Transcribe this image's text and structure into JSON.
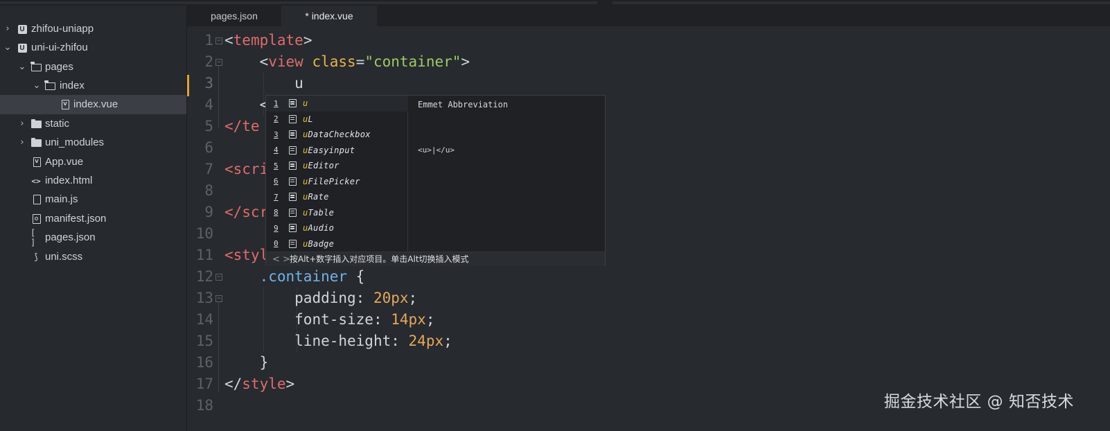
{
  "sidebar": {
    "items": [
      {
        "label": "zhifou-uniapp",
        "icon": "uniapp-project-icon"
      },
      {
        "label": "uni-ui-zhifou",
        "icon": "uniapp-project-icon"
      },
      {
        "label": "pages",
        "icon": "folder-open-icon"
      },
      {
        "label": "index",
        "icon": "folder-open-icon"
      },
      {
        "label": "index.vue",
        "icon": "vue-file-icon"
      },
      {
        "label": "static",
        "icon": "folder-icon"
      },
      {
        "label": "uni_modules",
        "icon": "folder-icon"
      },
      {
        "label": "App.vue",
        "icon": "vue-file-icon"
      },
      {
        "label": "index.html",
        "icon": "html-file-icon"
      },
      {
        "label": "main.js",
        "icon": "js-file-icon"
      },
      {
        "label": "manifest.json",
        "icon": "manifest-file-icon"
      },
      {
        "label": "pages.json",
        "icon": "json-file-icon"
      },
      {
        "label": "uni.scss",
        "icon": "scss-file-icon"
      }
    ],
    "selected": "index.vue"
  },
  "tabs": [
    {
      "label": "pages.json",
      "active": false
    },
    {
      "label": "* index.vue",
      "active": true
    }
  ],
  "editor": {
    "line_numbers": [
      "1",
      "2",
      "3",
      "4",
      "5",
      "6",
      "7",
      "8",
      "9",
      "10",
      "11",
      "12",
      "13",
      "14",
      "15",
      "16",
      "17",
      "18"
    ],
    "current_line": 3,
    "code": {
      "l1": {
        "open": "<",
        "tag": "template",
        "close": ">"
      },
      "l2": {
        "indent": "    ",
        "open": "<",
        "tag": "view",
        "attr": " class",
        "eq": "=",
        "str": "\"container\"",
        "close": ">"
      },
      "l3": {
        "indent": "        ",
        "text": "u"
      },
      "l4": {
        "indent": "    ",
        "text": "<"
      },
      "l5": {
        "text": "</te"
      },
      "l7": {
        "text": "<scri"
      },
      "l9": {
        "text": "</scr"
      },
      "l11": {
        "text": "<styl"
      },
      "l12": {
        "indent": "    ",
        "selector": ".container",
        "brace": " {"
      },
      "l13": {
        "indent": "        ",
        "prop": "padding",
        "colon": ": ",
        "value": "20px",
        "semi": ";"
      },
      "l14": {
        "indent": "        ",
        "prop": "font-size",
        "colon": ": ",
        "value": "14px",
        "semi": ";"
      },
      "l15": {
        "indent": "        ",
        "prop": "line-height",
        "colon": ": ",
        "value": "24px",
        "semi": ";"
      },
      "l16": {
        "indent": "    ",
        "text": "}"
      },
      "l17": {
        "open": "</",
        "tag": "style",
        "close": ">"
      }
    }
  },
  "autocomplete": {
    "items": [
      {
        "num": "1",
        "match": "u",
        "rest": ""
      },
      {
        "num": "2",
        "match": "u",
        "rest": "L"
      },
      {
        "num": "3",
        "match": "u",
        "rest": "DataCheckbox"
      },
      {
        "num": "4",
        "match": "u",
        "rest": "Easyinput"
      },
      {
        "num": "5",
        "match": "u",
        "rest": "Editor"
      },
      {
        "num": "6",
        "match": "u",
        "rest": "FilePicker"
      },
      {
        "num": "7",
        "match": "u",
        "rest": "Rate"
      },
      {
        "num": "8",
        "match": "u",
        "rest": "Table"
      },
      {
        "num": "9",
        "match": "u",
        "rest": "Audio"
      },
      {
        "num": "0",
        "match": "u",
        "rest": "Badge"
      }
    ],
    "detail_title": "Emmet Abbreviation",
    "detail_preview": "<u>|</u>",
    "nav_glyphs": "< >",
    "hint": "按Alt+数字插入对应项目。单击Alt切换插入模式"
  },
  "watermark": "掘金技术社区 @ 知否技术",
  "colors": {
    "editor_bg": "#272a2e",
    "sidebar_bg": "#262a2e",
    "tag": "#e06c6c",
    "attr": "#e5b54a",
    "string": "#9ccc65",
    "number": "#e6a85a",
    "selector": "#6fb3e8",
    "current_line_marker": "#e0a530",
    "match_highlight": "#f0c02a"
  }
}
